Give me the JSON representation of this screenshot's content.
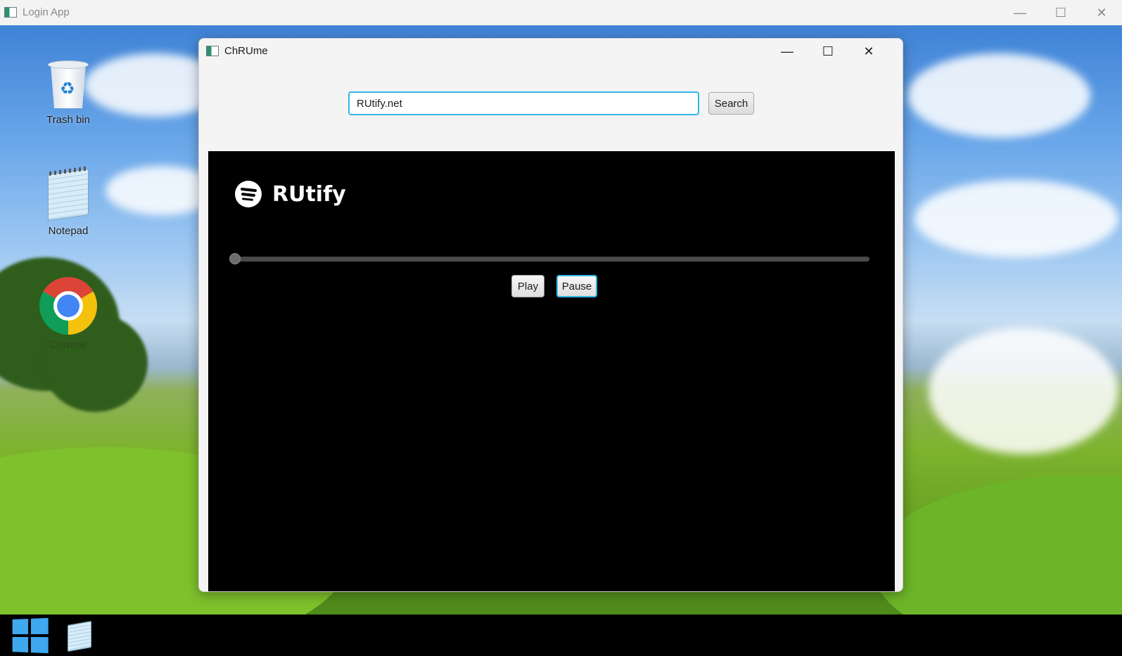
{
  "outer_window": {
    "title": "Login App",
    "controls": {
      "minimize": "—",
      "maximize": "☐",
      "close": "✕"
    }
  },
  "desktop": {
    "icons": [
      {
        "label": "Trash bin",
        "icon": "trash-bin-icon"
      },
      {
        "label": "Notepad",
        "icon": "notepad-icon"
      },
      {
        "label": "Chrome",
        "icon": "chrome-icon"
      }
    ]
  },
  "browser": {
    "title": "ChRUme",
    "controls": {
      "minimize": "—",
      "maximize": "☐",
      "close": "✕"
    },
    "url_value": "RUtify.net",
    "search_label": "Search",
    "accent_color": "#31b7e6"
  },
  "page": {
    "brand": "RUtify",
    "logo_icon": "spotify-logo-icon",
    "background": "#000000",
    "player": {
      "progress": 0,
      "play_label": "Play",
      "pause_label": "Pause"
    }
  },
  "taskbar": {
    "items": [
      "start-icon",
      "notepad-icon"
    ]
  }
}
